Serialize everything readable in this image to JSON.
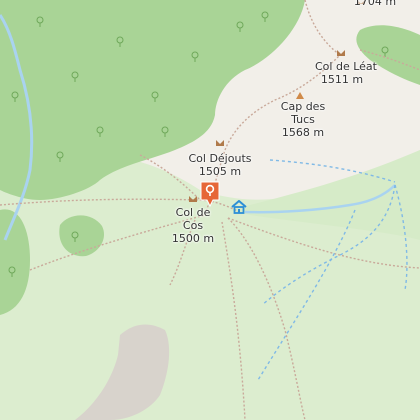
{
  "map": {
    "colors": {
      "meadow": "#dcedcf",
      "forest": "#a9d496",
      "forest_dark": "#8fbf7f",
      "bare": "#f2efe9",
      "rock": "#d8d3cc",
      "stream": "#a9d3f0",
      "path": "#c9a99a",
      "ski": "#7fb9e6",
      "marker": "#e66638",
      "peak": "#d08a49",
      "shelter": "#2d8fd6"
    },
    "labels": {
      "top_elevation": "1704 m",
      "col_de_leat": {
        "name": "Col de",
        "name2": "Léat",
        "elevation": "1511 m"
      },
      "cap_des_tucs": {
        "name": "Cap des",
        "name2": "Tucs",
        "elevation": "1568 m"
      },
      "col_dejouts": {
        "name": "Col Déjouts",
        "elevation": "1505 m"
      },
      "col_de_cos": {
        "name": "Col de",
        "name2": "Cos",
        "elevation": "1500 m"
      }
    },
    "icons": {
      "marker": "map-pin-icon",
      "shelter": "shelter-hut-icon",
      "peak": "peak-triangle-icon",
      "pass": "mountain-pass-icon"
    }
  }
}
